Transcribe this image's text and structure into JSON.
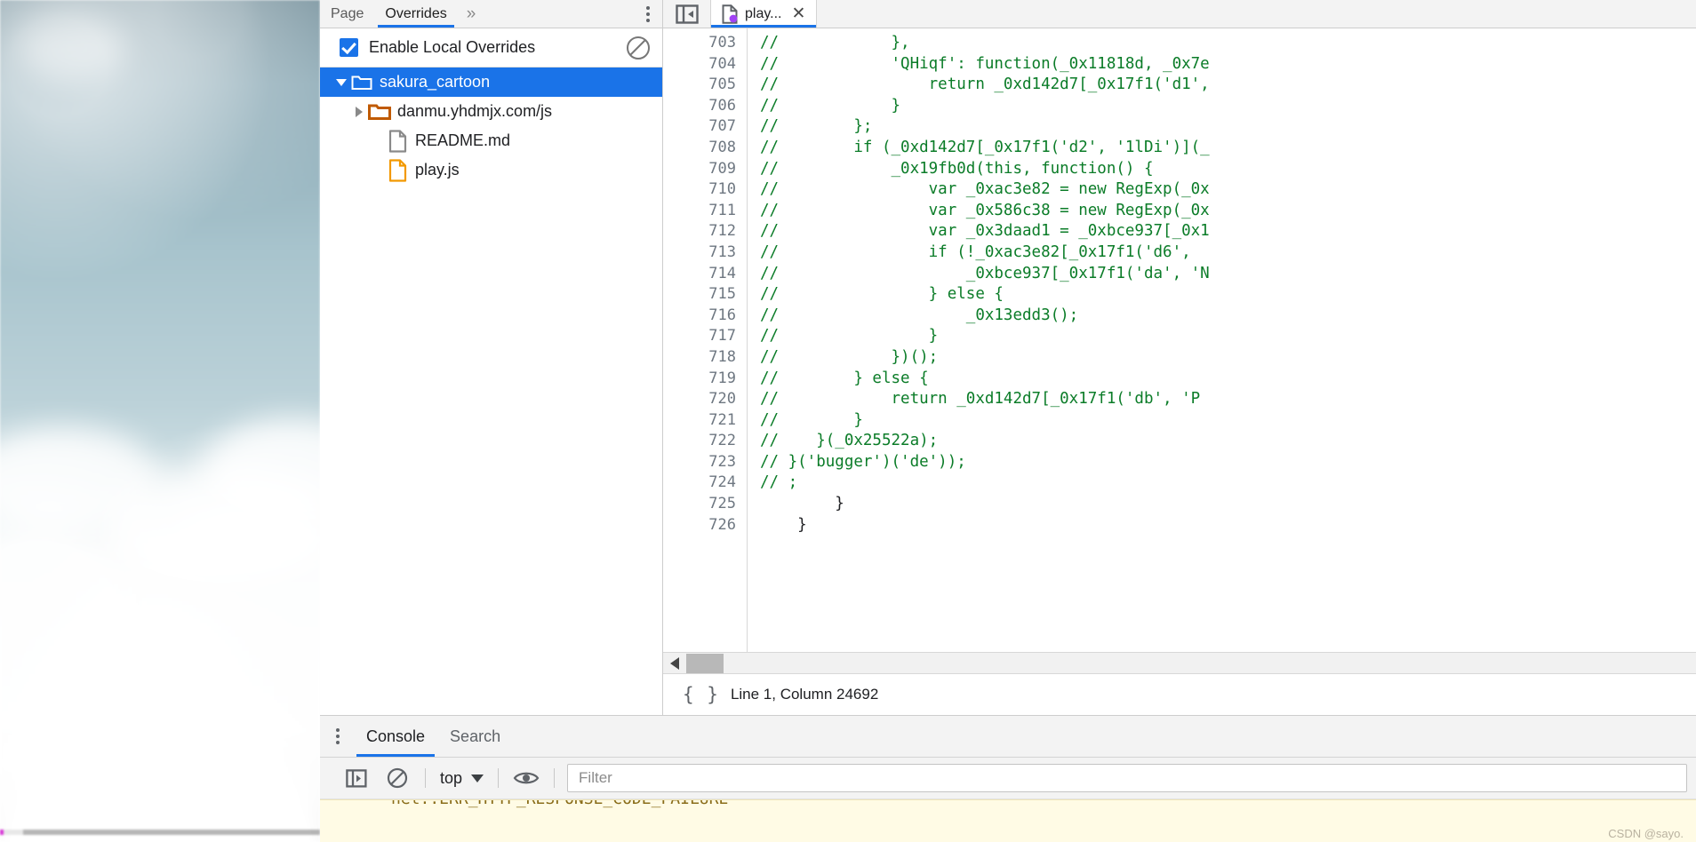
{
  "navigator": {
    "tabs": [
      {
        "label": "Page",
        "active": false
      },
      {
        "label": "Overrides",
        "active": true
      }
    ],
    "more_label": "»",
    "overrides": {
      "checkbox_label": "Enable Local Overrides",
      "checked": true,
      "clear_icon": "clear-overrides-icon"
    },
    "tree": [
      {
        "label": "sakura_cartoon",
        "type": "folder",
        "icon": "folder-icon",
        "icon_color": "#ffffff",
        "depth": 0,
        "expanded": true,
        "selected": true
      },
      {
        "label": "danmu.yhdmjx.com/js",
        "type": "folder",
        "icon": "folder-icon",
        "icon_color": "#c05a00",
        "depth": 1,
        "expanded": false,
        "selected": false
      },
      {
        "label": "README.md",
        "type": "file",
        "icon": "document-icon",
        "icon_color": "#8a8a8a",
        "depth": 2,
        "expanded": null,
        "selected": false
      },
      {
        "label": "play.js",
        "type": "file",
        "icon": "document-icon",
        "icon_color": "#f29900",
        "depth": 2,
        "expanded": null,
        "selected": false
      }
    ]
  },
  "editor": {
    "panel_toggle_icon": "show-navigator-icon",
    "tab": {
      "label": "play...",
      "icon": "js-file-mapped-icon",
      "dot_color": "#a142f4",
      "close_label": "✕"
    },
    "line_start": 703,
    "lines": [
      {
        "n": 703,
        "text": "//            },",
        "comment": true
      },
      {
        "n": 704,
        "text": "//            'QHiqf': function(_0x11818d, _0x7e",
        "comment": true
      },
      {
        "n": 705,
        "text": "//                return _0xd142d7[_0x17f1('d1',",
        "comment": true
      },
      {
        "n": 706,
        "text": "//            }",
        "comment": true
      },
      {
        "n": 707,
        "text": "//        };",
        "comment": true
      },
      {
        "n": 708,
        "text": "//        if (_0xd142d7[_0x17f1('d2', '1lDi')](_",
        "comment": true
      },
      {
        "n": 709,
        "text": "//            _0x19fb0d(this, function() {",
        "comment": true
      },
      {
        "n": 710,
        "text": "//                var _0xac3e82 = new RegExp(_0x",
        "comment": true
      },
      {
        "n": 711,
        "text": "//                var _0x586c38 = new RegExp(_0x",
        "comment": true
      },
      {
        "n": 712,
        "text": "//                var _0x3daad1 = _0xbce937[_0x1",
        "comment": true
      },
      {
        "n": 713,
        "text": "//                if (!_0xac3e82[_0x17f1('d6', ",
        "comment": true
      },
      {
        "n": 714,
        "text": "//                    _0xbce937[_0x17f1('da', 'N",
        "comment": true
      },
      {
        "n": 715,
        "text": "//                } else {",
        "comment": true
      },
      {
        "n": 716,
        "text": "//                    _0x13edd3();",
        "comment": true
      },
      {
        "n": 717,
        "text": "//                }",
        "comment": true
      },
      {
        "n": 718,
        "text": "//            })();",
        "comment": true
      },
      {
        "n": 719,
        "text": "//        } else {",
        "comment": true
      },
      {
        "n": 720,
        "text": "//            return _0xd142d7[_0x17f1('db', 'P",
        "comment": true
      },
      {
        "n": 721,
        "text": "//        }",
        "comment": true
      },
      {
        "n": 722,
        "text": "//    }(_0x25522a);",
        "comment": true
      },
      {
        "n": 723,
        "text": "// }('bugger')('de'));",
        "comment": true
      },
      {
        "n": 724,
        "text": "// ;",
        "comment": true
      },
      {
        "n": 725,
        "text": "        }",
        "comment": false
      },
      {
        "n": 726,
        "text": "    }",
        "comment": false
      }
    ],
    "scrollbar": {
      "left_arrow_icon": "scroll-left-icon"
    },
    "status": {
      "pretty_print_icon": "{ }",
      "text": "Line 1, Column 24692"
    }
  },
  "drawer": {
    "menu_icon": "more-options-icon",
    "tabs": [
      {
        "label": "Console",
        "active": true
      },
      {
        "label": "Search",
        "active": false
      }
    ],
    "toolbar": {
      "sidebar_icon": "console-sidebar-icon",
      "clear_icon": "clear-console-icon",
      "context_value": "top",
      "eye_icon": "live-expression-icon",
      "filter_placeholder": "Filter"
    },
    "message": "net::ERR_HTTP_RESPONSE_CODE_FAILURE"
  },
  "watermark": "CSDN @sayo.",
  "colors": {
    "accent": "#1a73e8",
    "comment_green": "#0b7c28",
    "folder_orange": "#c05a00",
    "js_orange": "#f29900",
    "warning_bg": "#fffbe5",
    "mapped_dot": "#a142f4"
  }
}
